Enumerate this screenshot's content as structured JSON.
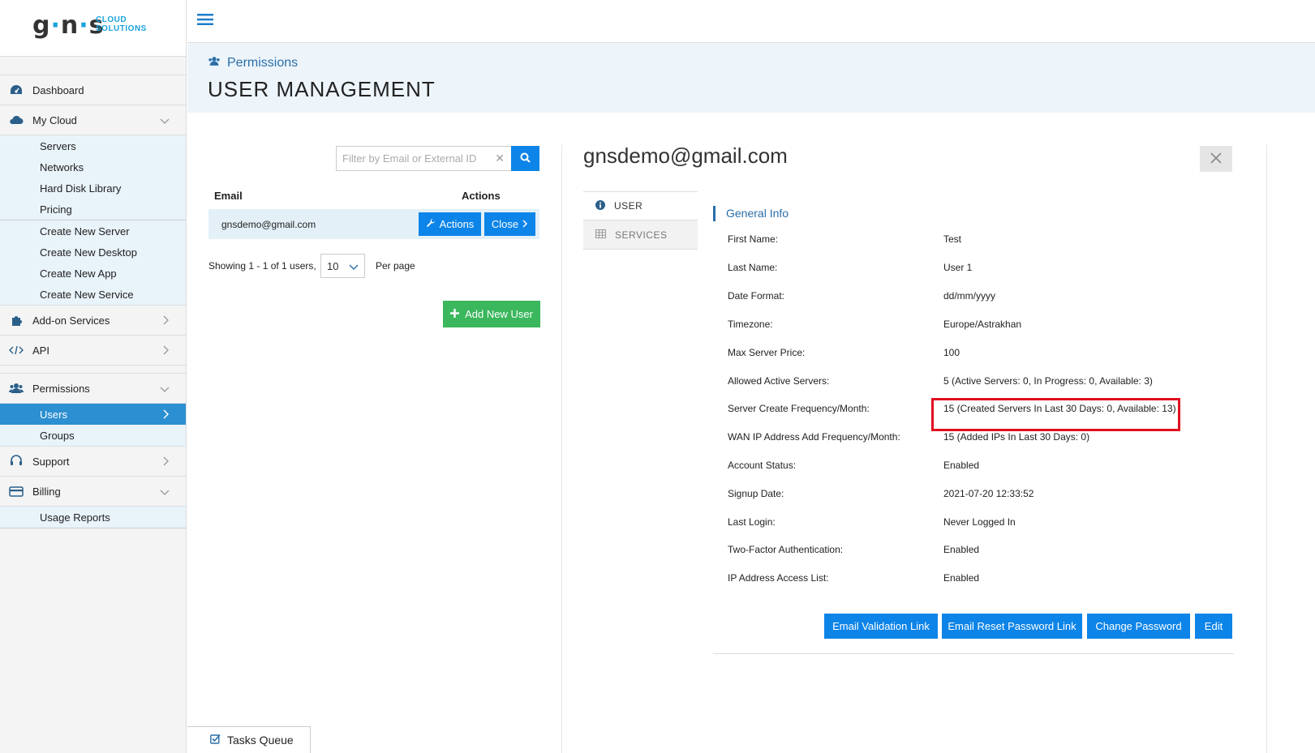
{
  "brand": {
    "logo_main": "g·n·s",
    "logo_sub_line1": "CLOUD",
    "logo_sub_line2": "SOLUTIONS"
  },
  "sidebar": {
    "dashboard": "Dashboard",
    "my_cloud": "My Cloud",
    "my_cloud_items": [
      "Servers",
      "Networks",
      "Hard Disk Library",
      "Pricing"
    ],
    "create_items": [
      "Create New Server",
      "Create New Desktop",
      "Create New App",
      "Create New Service"
    ],
    "addon": "Add-on Services",
    "api": "API",
    "permissions": "Permissions",
    "users": "Users",
    "groups": "Groups",
    "support": "Support",
    "billing": "Billing",
    "usage_reports": "Usage Reports"
  },
  "header": {
    "breadcrumb": "Permissions",
    "title": "USER MANAGEMENT"
  },
  "users_list": {
    "filter_placeholder": "Filter by Email or External ID",
    "col_email": "Email",
    "col_actions": "Actions",
    "rows": [
      {
        "email": "gnsdemo@gmail.com",
        "actions_label": "Actions",
        "close_label": "Close"
      }
    ],
    "showing": "Showing 1 - 1 of 1 users,",
    "per_page_value": "10",
    "per_page_label": "Per page",
    "add_user": "Add New User"
  },
  "detail": {
    "title": "gnsdemo@gmail.com",
    "tabs": {
      "user": "USER",
      "services": "SERVICES"
    },
    "section_title": "General Info",
    "fields": [
      {
        "label": "First Name:",
        "value": "Test"
      },
      {
        "label": "Last Name:",
        "value": "User 1"
      },
      {
        "label": "Date Format:",
        "value": "dd/mm/yyyy"
      },
      {
        "label": "Timezone:",
        "value": "Europe/Astrakhan"
      },
      {
        "label": "Max Server Price:",
        "value": "100"
      },
      {
        "label": "Allowed Active Servers:",
        "value": "5 (Active Servers: 0, In Progress: 0, Available: 3)"
      },
      {
        "label": "Server Create Frequency/Month:",
        "value": "15 (Created Servers In Last 30 Days: 0, Available: 13)"
      },
      {
        "label": "WAN IP Address Add Frequency/Month:",
        "value": "15 (Added IPs In Last 30 Days: 0)"
      },
      {
        "label": "Account Status:",
        "value": "Enabled"
      },
      {
        "label": "Signup Date:",
        "value": "2021-07-20 12:33:52"
      },
      {
        "label": "Last Login:",
        "value": "Never Logged In"
      },
      {
        "label": "Two-Factor Authentication:",
        "value": "Enabled"
      },
      {
        "label": "IP Address Access List:",
        "value": "Enabled"
      }
    ],
    "buttons": {
      "email_validation": "Email Validation Link",
      "email_reset": "Email Reset Password Link",
      "change_password": "Change Password",
      "edit": "Edit"
    }
  },
  "tasks_queue": "Tasks Queue",
  "colors": {
    "primary": "#0d84e8",
    "success": "#3bb75d",
    "highlight": "#e01020",
    "active_nav": "#2c8fd1",
    "brand_accent": "#1aa3dc"
  }
}
